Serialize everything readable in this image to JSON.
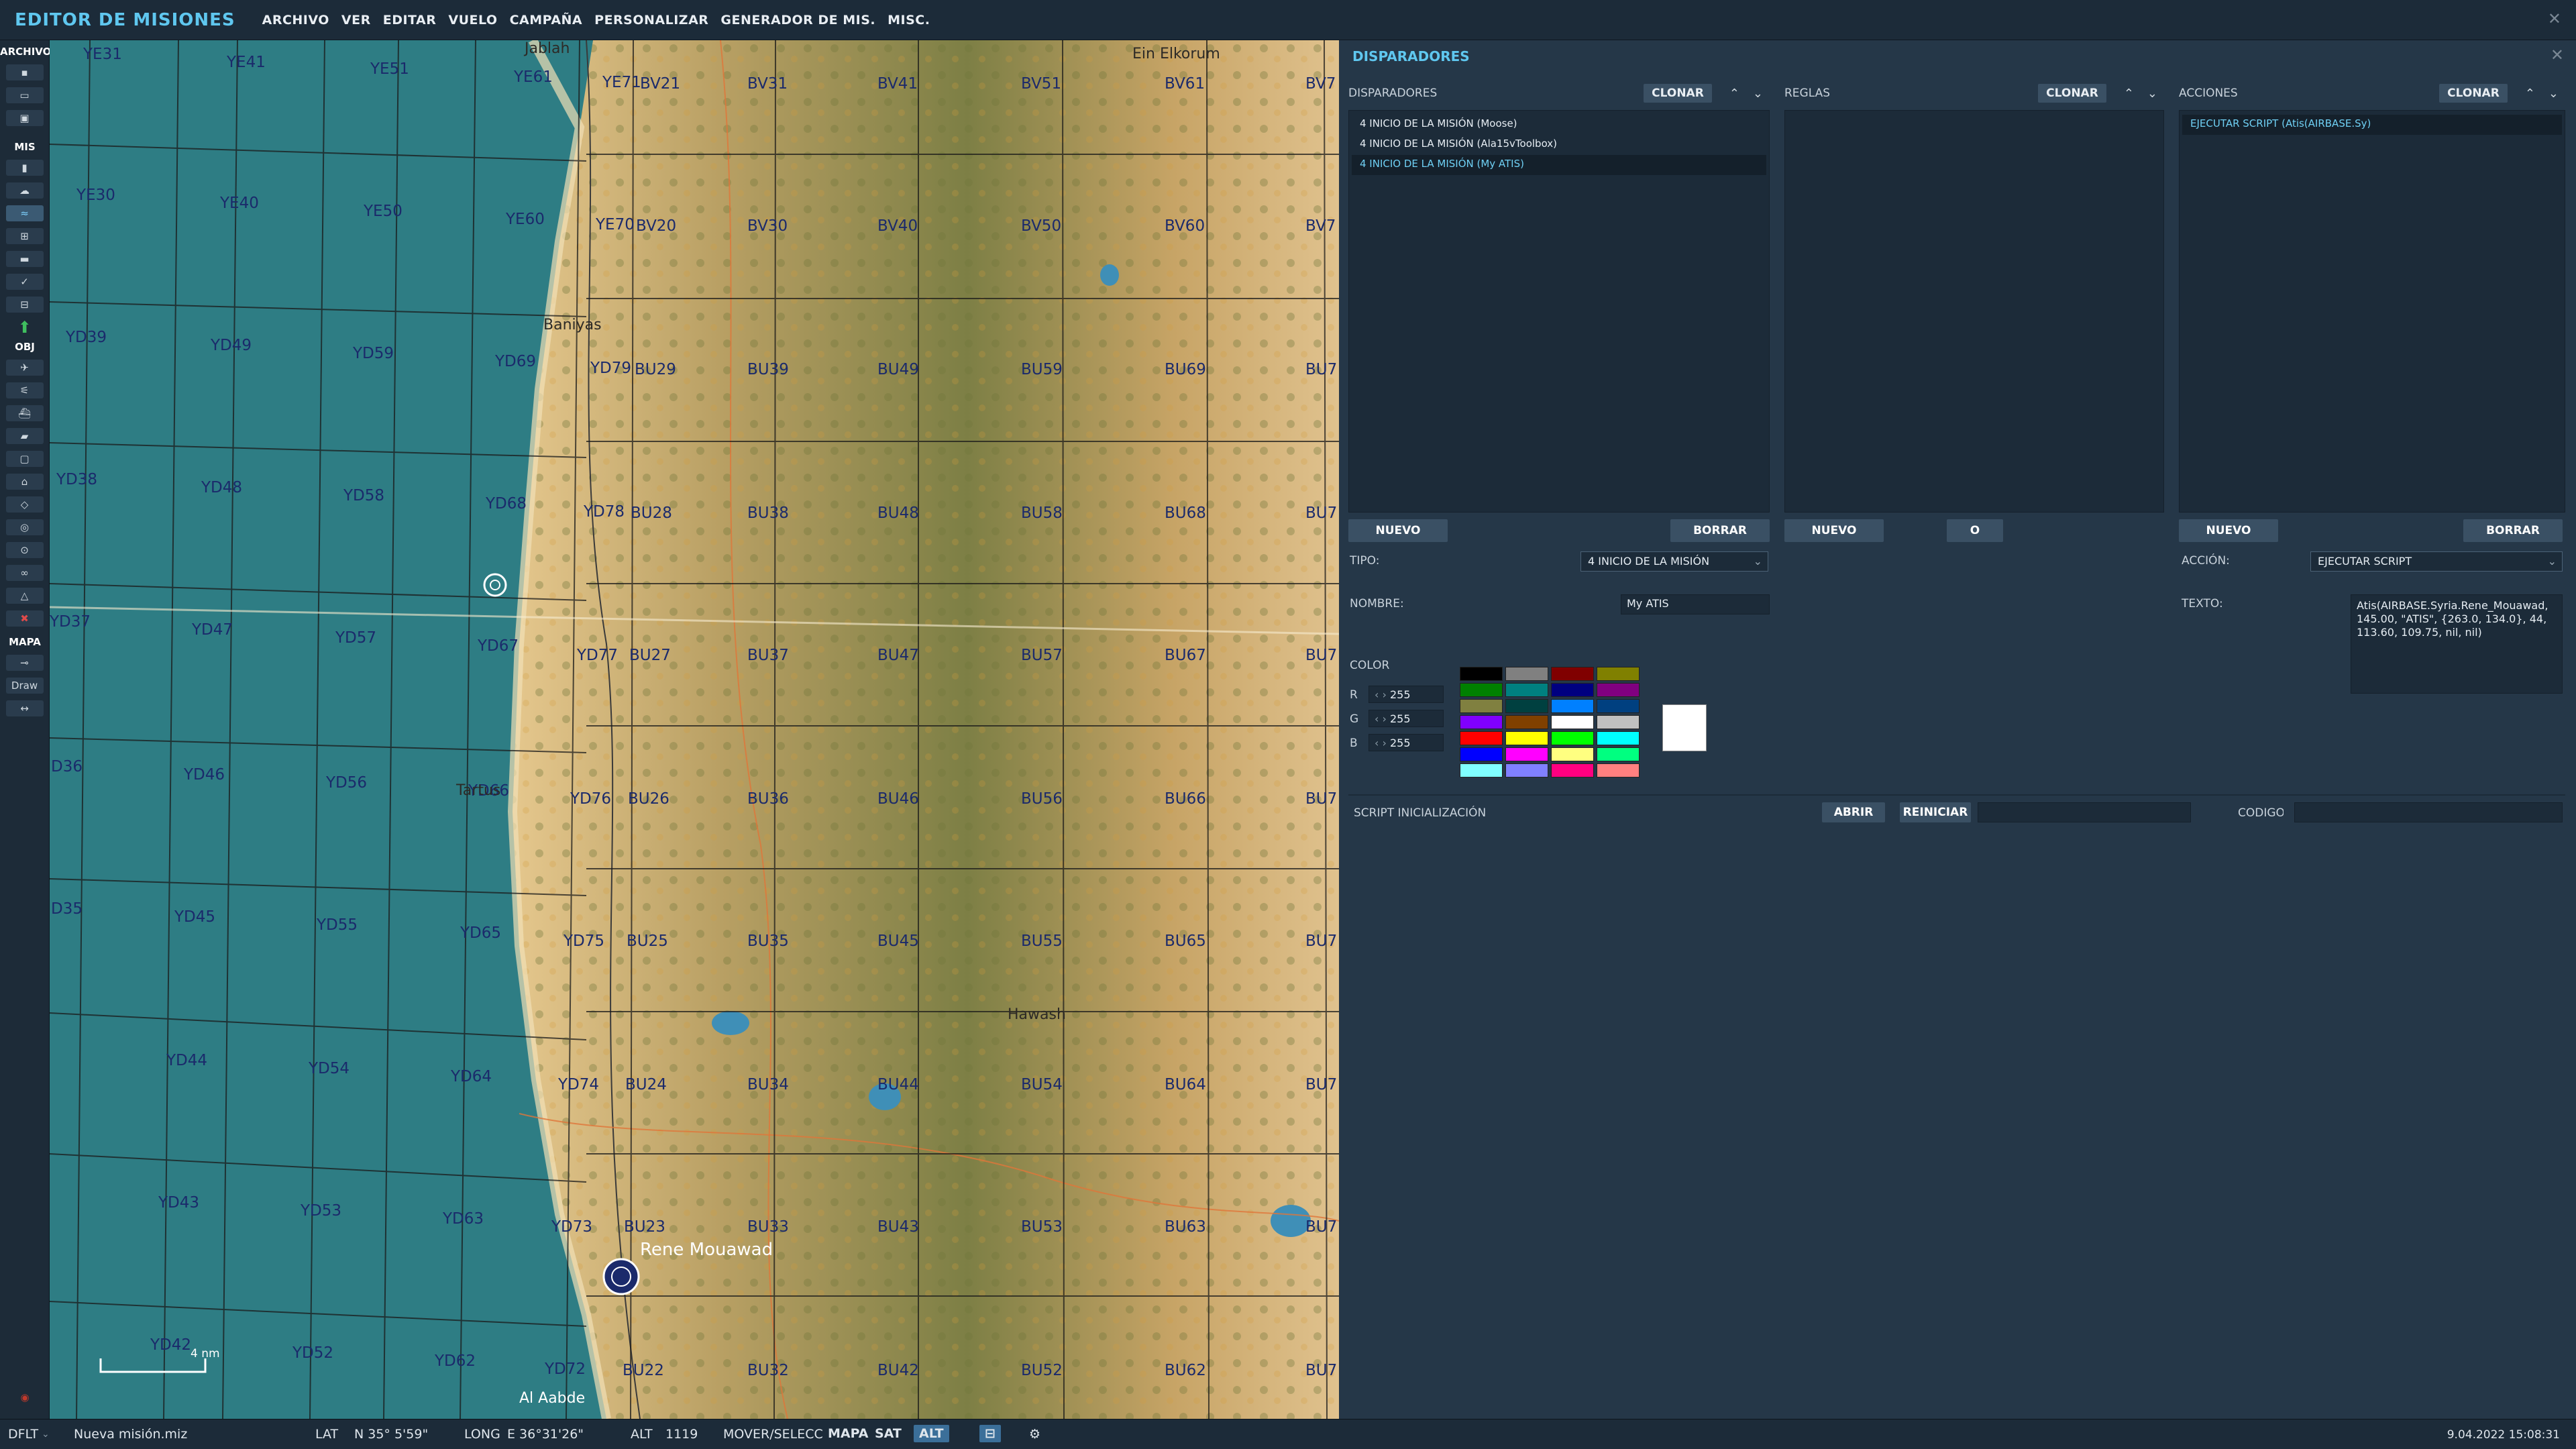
{
  "app": {
    "title": "EDITOR DE MISIONES",
    "close_glyph": "✕"
  },
  "menu": [
    "ARCHIVO",
    "VER",
    "EDITAR",
    "VUELO",
    "CAMPAÑA",
    "PERSONALIZAR",
    "GENERADOR DE MIS.",
    "MISC."
  ],
  "left_toolbar": {
    "sections": {
      "archivo": "ARCHIVO",
      "mis": "MIS",
      "obj": "OBJ",
      "mapa": "MAPA",
      "draw": "Draw"
    }
  },
  "map": {
    "scale_label": "4 nm",
    "labels": {
      "YE31": "YE31",
      "YE41": "YE41",
      "YE51": "YE51",
      "YE61": "YE61",
      "YE71": "YE71",
      "BV21": "BV21",
      "BV31": "BV31",
      "BV41": "BV41",
      "BV51": "BV51",
      "BV61": "BV61",
      "BV71": "BV7",
      "YE30": "YE30",
      "YE40": "YE40",
      "YE50": "YE50",
      "YE60": "YE60",
      "YE70": "YE70",
      "BV20": "BV20",
      "BV30": "BV30",
      "BV40": "BV40",
      "BV50": "BV50",
      "BV60": "BV60",
      "BV70": "BV7",
      "YD39": "YD39",
      "YD49": "YD49",
      "YD59": "YD59",
      "YD69": "YD69",
      "YD79": "YD79",
      "BU29": "BU29",
      "BU39": "BU39",
      "BU49": "BU49",
      "BU59": "BU59",
      "BU69": "BU69",
      "BU79": "BU7",
      "YD38": "YD38",
      "YD48": "YD48",
      "YD58": "YD58",
      "YD68": "YD68",
      "YD78": "YD78",
      "BU28": "BU28",
      "BU38": "BU38",
      "BU48": "BU48",
      "BU58": "BU58",
      "BU68": "BU68",
      "BU78": "BU7",
      "YD37": "YD37",
      "YD47": "YD47",
      "YD57": "YD57",
      "YD67": "YD67",
      "YD77": "YD77",
      "BU27": "BU27",
      "BU37": "BU37",
      "BU47": "BU47",
      "BU57": "BU57",
      "BU67": "BU67",
      "BU77": "BU7",
      "YD36": "D36",
      "YD46": "YD46",
      "YD56": "YD56",
      "YD66": "YD66",
      "YD76": "YD76",
      "BU26": "BU26",
      "BU36": "BU36",
      "BU46": "BU46",
      "BU56": "BU56",
      "BU66": "BU66",
      "BU76": "BU7",
      "YD35": "D35",
      "YD45": "YD45",
      "YD55": "YD55",
      "YD65": "YD65",
      "YD75": "YD75",
      "BU25": "BU25",
      "BU35": "BU35",
      "BU45": "BU45",
      "BU55": "BU55",
      "BU65": "BU65",
      "BU75": "BU7",
      "YD44": "YD44",
      "YD54": "YD54",
      "YD64": "YD64",
      "YD74": "YD74",
      "BU24": "BU24",
      "BU34": "BU34",
      "BU44": "BU44",
      "BU54": "BU54",
      "BU64": "BU64",
      "BU74": "BU7",
      "YD43": "YD43",
      "YD53": "YD53",
      "YD63": "YD63",
      "YD73": "YD73",
      "BU23": "BU23",
      "BU33": "BU33",
      "BU43": "BU43",
      "BU53": "BU53",
      "BU63": "BU63",
      "BU73": "BU7",
      "YD42": "YD42",
      "YD52": "YD52",
      "YD62": "YD62",
      "YD72": "YD72",
      "BU22": "BU22",
      "BU32": "BU32",
      "BU42": "BU42",
      "BU52": "BU52",
      "BU62": "BU62",
      "BU72": "BU7"
    },
    "places": {
      "jablah": "Jablah",
      "ein_elkorum": "Ein Elkorum",
      "baniyas": "Baniyas",
      "tartus": "Tartus",
      "hawash": "Hawash",
      "rene_mouawad": "Rene Mouawad",
      "al_aabde": "Al Aabde"
    }
  },
  "panel": {
    "title": "DISPARADORES",
    "close_glyph": "✕",
    "triggers": {
      "header": "DISPARADORES",
      "clone": "CLONAR",
      "items": [
        "4 INICIO DE LA MISIÓN (Moose)",
        "4 INICIO DE LA MISIÓN (Ala15vToolbox)",
        "4 INICIO DE LA MISIÓN (My ATIS)"
      ],
      "selected_index": 2,
      "new": "NUEVO",
      "delete": "BORRAR"
    },
    "rules": {
      "header": "REGLAS",
      "clone": "CLONAR",
      "new": "NUEVO",
      "or": "O"
    },
    "actions": {
      "header": "ACCIONES",
      "clone": "CLONAR",
      "items": [
        "EJECUTAR SCRIPT (Atis(AIRBASE.Sy)"
      ],
      "new": "NUEVO",
      "delete": "BORRAR"
    },
    "form": {
      "tipo_label": "TIPO:",
      "tipo_value": "4 INICIO DE LA MISIÓN",
      "nombre_label": "NOMBRE:",
      "nombre_value": "My ATIS",
      "color_label": "COLOR",
      "r_label": "R",
      "r_value": "255",
      "g_label": "G",
      "g_value": "255",
      "b_label": "B",
      "b_value": "255",
      "accion_label": "ACCIÓN:",
      "accion_value": "EJECUTAR SCRIPT",
      "texto_label": "TEXTO:",
      "texto_value": "Atis(AIRBASE.Syria.Rene_Mouawad, 145.00, \"ATIS\", {263.0, 134.0}, 44, 113.60, 109.75, nil, nil)"
    },
    "script": {
      "label": "SCRIPT INICIALIZACIÓN",
      "open": "ABRIR",
      "reset": "REINICIAR",
      "code_label": "CODIGO"
    },
    "palette": [
      "#000000",
      "#808080",
      "#800000",
      "#808000",
      "#008000",
      "#008080",
      "#000080",
      "#800080",
      "#808040",
      "#004040",
      "#0080ff",
      "#004080",
      "#8000ff",
      "#804000",
      "#ffffff",
      "#c0c0c0",
      "#ff0000",
      "#ffff00",
      "#00ff00",
      "#00ffff",
      "#0000ff",
      "#ff00ff",
      "#ffff80",
      "#00ff80",
      "#80ffff",
      "#8080ff",
      "#ff0080",
      "#ff8080"
    ],
    "selected_color": "#ffffff"
  },
  "status": {
    "profile": "DFLT",
    "file": "Nueva misión.miz",
    "lat_label": "LAT",
    "lat_value": "N 35° 5'59\"",
    "long_label": "LONG",
    "long_value": "E 36°31'26\"",
    "alt_label": "ALT",
    "alt_value": "1119",
    "mode": "MOVER/SELECC",
    "mapa": "MAPA",
    "sat": "SAT",
    "alt_btn": "ALT",
    "datetime": "9.04.2022 15:08:31"
  }
}
